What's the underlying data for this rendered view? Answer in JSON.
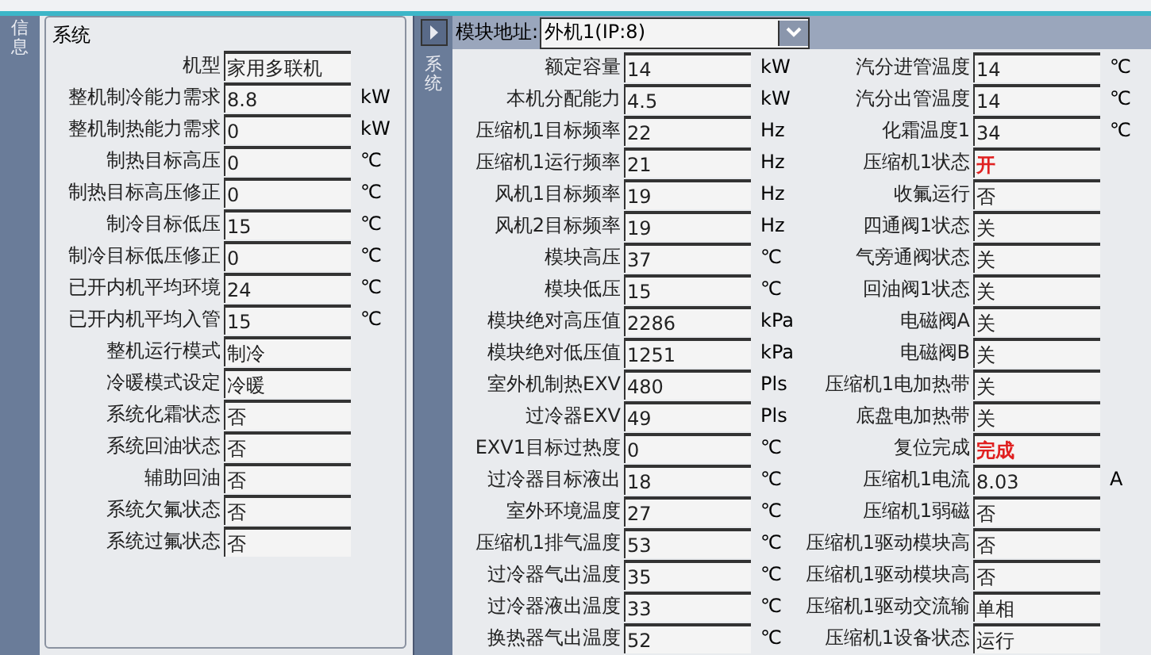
{
  "side_tab": {
    "label": "信息"
  },
  "system_panel": {
    "title": "系统",
    "rows": [
      {
        "label": "机型",
        "value": "家用多联机"
      },
      {
        "label": "整机制冷能力需求",
        "value": "8.8",
        "unit": "kW"
      },
      {
        "label": "整机制热能力需求",
        "value": "0",
        "unit": "kW"
      },
      {
        "label": "制热目标高压",
        "value": "0",
        "unit": "℃"
      },
      {
        "label": "制热目标高压修正",
        "value": "0",
        "unit": "℃"
      },
      {
        "label": "制冷目标低压",
        "value": "15",
        "unit": "℃"
      },
      {
        "label": "制冷目标低压修正",
        "value": "0",
        "unit": "℃"
      },
      {
        "label": "已开内机平均环境",
        "value": "24",
        "unit": "℃"
      },
      {
        "label": "已开内机平均入管",
        "value": "15",
        "unit": "℃"
      },
      {
        "label": "整机运行模式",
        "value": "制冷"
      },
      {
        "label": "冷暖模式设定",
        "value": "冷暖"
      },
      {
        "label": "系统化霜状态",
        "value": "否"
      },
      {
        "label": "系统回油状态",
        "value": "否"
      },
      {
        "label": "辅助回油",
        "value": "否"
      },
      {
        "label": "系统欠氟状态",
        "value": "否"
      },
      {
        "label": "系统过氟状态",
        "value": "否"
      }
    ]
  },
  "module_panel": {
    "side_tab": "系统",
    "address_label": "模块地址:",
    "address_value": "外机1(IP:8)",
    "column_1": [
      {
        "label": "额定容量",
        "value": "14",
        "unit": "kW"
      },
      {
        "label": "本机分配能力",
        "value": "4.5",
        "unit": "kW"
      },
      {
        "label": "压缩机1目标频率",
        "value": "22",
        "unit": "Hz"
      },
      {
        "label": "压缩机1运行频率",
        "value": "21",
        "unit": "Hz"
      },
      {
        "label": "风机1目标频率",
        "value": "19",
        "unit": "Hz"
      },
      {
        "label": "风机2目标频率",
        "value": "19",
        "unit": "Hz"
      },
      {
        "label": "模块高压",
        "value": "37",
        "unit": "℃"
      },
      {
        "label": "模块低压",
        "value": "15",
        "unit": "℃"
      },
      {
        "label": "模块绝对高压值",
        "value": "2286",
        "unit": "kPa"
      },
      {
        "label": "模块绝对低压值",
        "value": "1251",
        "unit": "kPa"
      },
      {
        "label": "室外机制热EXV",
        "value": "480",
        "unit": "Pls"
      },
      {
        "label": "过冷器EXV",
        "value": "49",
        "unit": "Pls"
      },
      {
        "label": "EXV1目标过热度",
        "value": "0",
        "unit": "℃"
      },
      {
        "label": "过冷器目标液出",
        "value": "18",
        "unit": "℃"
      },
      {
        "label": "室外环境温度",
        "value": "27",
        "unit": "℃"
      },
      {
        "label": "压缩机1排气温度",
        "value": "53",
        "unit": "℃"
      },
      {
        "label": "过冷器气出温度",
        "value": "35",
        "unit": "℃"
      },
      {
        "label": "过冷器液出温度",
        "value": "33",
        "unit": "℃"
      },
      {
        "label": "换热器气出温度",
        "value": "52",
        "unit": "℃"
      }
    ],
    "column_2": [
      {
        "label": "汽分进管温度",
        "value": "14",
        "unit": "℃",
        "alarm": false
      },
      {
        "label": "汽分出管温度",
        "value": "14",
        "unit": "℃",
        "alarm": false
      },
      {
        "label": "化霜温度1",
        "value": "34",
        "unit": "℃",
        "alarm": false
      },
      {
        "label": "压缩机1状态",
        "value": "开",
        "alarm": true
      },
      {
        "label": "收氟运行",
        "value": "否",
        "alarm": false
      },
      {
        "label": "四通阀1状态",
        "value": "关",
        "alarm": false
      },
      {
        "label": "气旁通阀状态",
        "value": "关",
        "alarm": false
      },
      {
        "label": "回油阀1状态",
        "value": "关",
        "alarm": false
      },
      {
        "label": "电磁阀A",
        "value": "关",
        "alarm": false
      },
      {
        "label": "电磁阀B",
        "value": "关",
        "alarm": false
      },
      {
        "label": "压缩机1电加热带",
        "value": "关",
        "alarm": false
      },
      {
        "label": "底盘电加热带",
        "value": "关",
        "alarm": false
      },
      {
        "label": "复位完成",
        "value": "完成",
        "alarm": true
      },
      {
        "label": "压缩机1电流",
        "value": "8.03",
        "unit": "A",
        "alarm": false
      },
      {
        "label": "压缩机1弱磁",
        "value": "否",
        "alarm": false
      },
      {
        "label": "压缩机1驱动模块高",
        "value": "否",
        "alarm": false
      },
      {
        "label": "压缩机1驱动模块高",
        "value": "否",
        "alarm": false
      },
      {
        "label": "压缩机1驱动交流输",
        "value": "单相",
        "alarm": false
      },
      {
        "label": "压缩机1设备状态",
        "value": "运行",
        "alarm": false
      }
    ]
  }
}
